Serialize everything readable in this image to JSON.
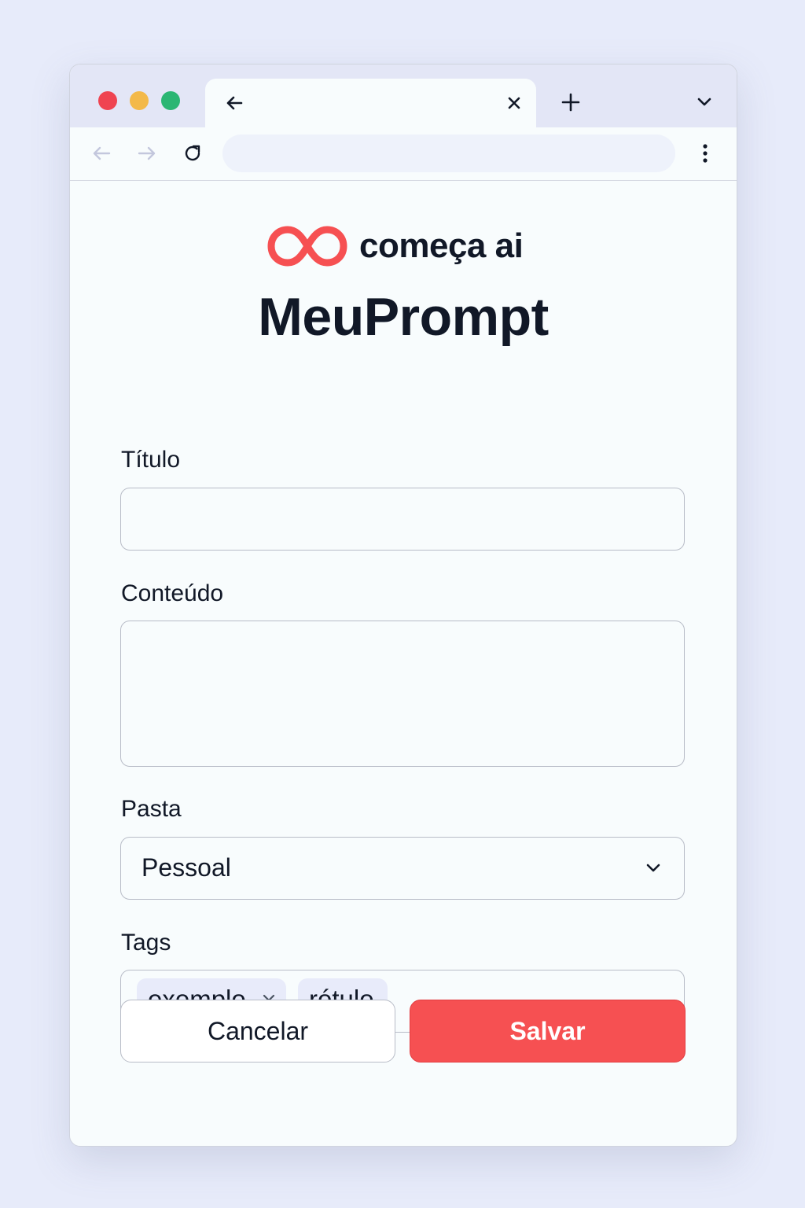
{
  "brand": {
    "name": "começa ai",
    "accent_color": "#f65052"
  },
  "page": {
    "title": "MeuPrompt"
  },
  "browser": {
    "address_value": ""
  },
  "form": {
    "title_label": "Título",
    "title_value": "",
    "content_label": "Conteúdo",
    "content_value": "",
    "folder_label": "Pasta",
    "folder_selected": "Pessoal",
    "tags_label": "Tags",
    "tags": [
      {
        "text": "exemplo",
        "removable": true
      },
      {
        "text": "rótulo",
        "removable": false
      }
    ]
  },
  "actions": {
    "cancel_label": "Cancelar",
    "save_label": "Salvar"
  },
  "icons": {
    "window_controls": [
      "close-dot",
      "minimize-dot",
      "maximize-dot"
    ],
    "tab": [
      "arrow-left-icon",
      "close-icon"
    ],
    "toolbar": [
      "back-icon",
      "forward-icon",
      "reload-icon",
      "more-vertical-icon"
    ],
    "other": [
      "plus-icon",
      "chevron-down-icon",
      "infinity-logo"
    ]
  }
}
